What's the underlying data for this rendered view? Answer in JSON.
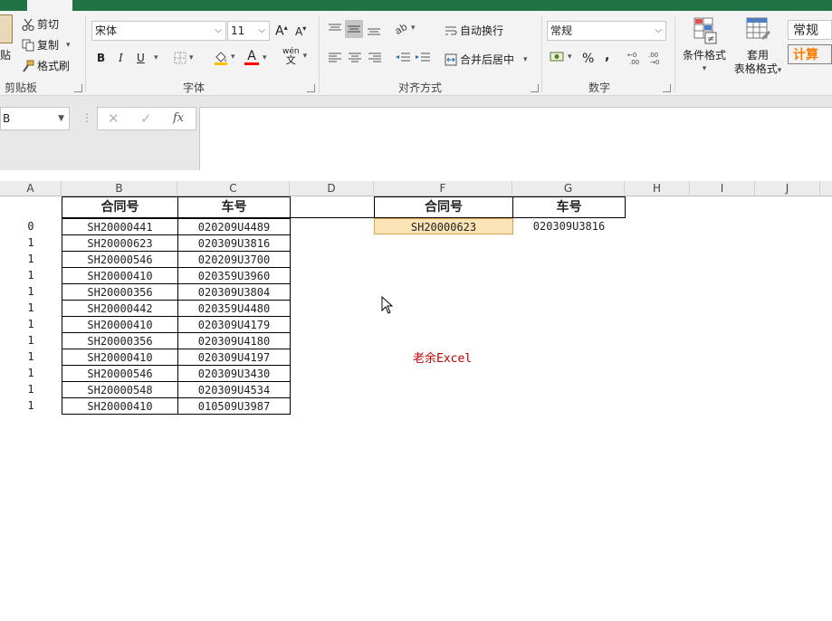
{
  "ribbon": {
    "clipboard": {
      "paste_label": "贴",
      "cut_label": "剪切",
      "copy_label": "复制",
      "format_painter_label": "格式刷",
      "group_label": "剪贴板"
    },
    "font": {
      "font_name": "宋体",
      "font_size": "11",
      "bold": "B",
      "italic": "I",
      "underline": "U",
      "font_color_glyph": "A",
      "font_color": "#ff0000",
      "phonetic_glyph": "wén",
      "phonetic_sub": "文",
      "group_label": "字体"
    },
    "alignment": {
      "wrap_text_label": "自动换行",
      "merge_center_label": "合并后居中",
      "group_label": "对齐方式"
    },
    "number": {
      "format_value": "常规",
      "group_label": "数字"
    },
    "styles": {
      "conditional_format_label": "条件格式",
      "table_format_line1": "套用",
      "table_format_line2": "表格格式",
      "style_normal_label": "常规",
      "style_calc_label": "计算"
    }
  },
  "formula_bar": {
    "name_box_value": "B",
    "fx_label": "fx",
    "formula_value": ""
  },
  "columns": [
    "A",
    "B",
    "C",
    "D",
    "F",
    "G",
    "H",
    "I",
    "J"
  ],
  "table1": {
    "headers": [
      "合同号",
      "车号"
    ],
    "rows": [
      {
        "a": "0",
        "b": "SH20000441",
        "c": "020209U4489"
      },
      {
        "a": "1",
        "b": "SH20000623",
        "c": "020309U3816"
      },
      {
        "a": "1",
        "b": "SH20000546",
        "c": "020209U3700"
      },
      {
        "a": "1",
        "b": "SH20000410",
        "c": "020359U3960"
      },
      {
        "a": "1",
        "b": "SH20000356",
        "c": "020309U3804"
      },
      {
        "a": "1",
        "b": "SH20000442",
        "c": "020359U4480"
      },
      {
        "a": "1",
        "b": "SH20000410",
        "c": "020309U4179"
      },
      {
        "a": "1",
        "b": "SH20000356",
        "c": "020309U4180"
      },
      {
        "a": "1",
        "b": "SH20000410",
        "c": "020309U4197"
      },
      {
        "a": "1",
        "b": "SH20000546",
        "c": "020309U3430"
      },
      {
        "a": "1",
        "b": "SH20000548",
        "c": "020309U4534"
      },
      {
        "a": "1",
        "b": "SH20000410",
        "c": "010509U3987"
      }
    ]
  },
  "lookup": {
    "headers": [
      "合同号",
      "车号"
    ],
    "contract_value": "SH20000623",
    "car_value": "020309U3816"
  },
  "watermark": "老余Excel",
  "colors": {
    "excel_green": "#217346",
    "selected_fill": "#fce4b6",
    "watermark": "#c00000"
  }
}
